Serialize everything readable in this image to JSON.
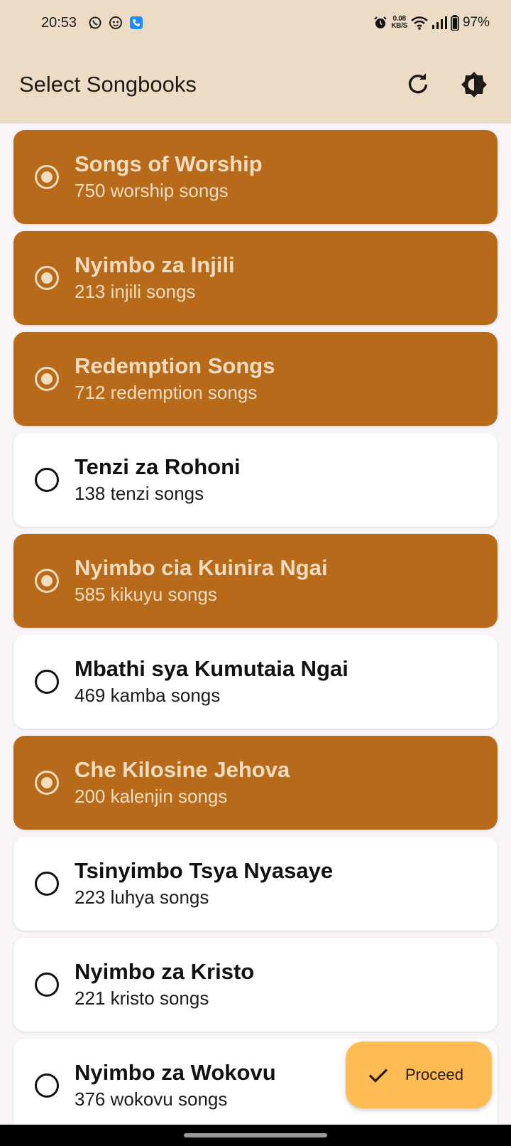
{
  "status_bar": {
    "time": "20:53",
    "net_speed_value": "0.08",
    "net_speed_unit": "KB/S",
    "battery": "97%",
    "notification_icons": [
      "whatsapp-icon",
      "messenger-icon",
      "phone-icon"
    ]
  },
  "app_bar": {
    "title": "Select Songbooks",
    "refresh_icon": "refresh-icon",
    "theme_icon": "brightness-icon"
  },
  "songbooks": [
    {
      "title": "Songs of Worship",
      "subtitle": "750 worship songs",
      "selected": true
    },
    {
      "title": "Nyimbo za Injili",
      "subtitle": "213 injili songs",
      "selected": true
    },
    {
      "title": "Redemption Songs",
      "subtitle": "712 redemption songs",
      "selected": true
    },
    {
      "title": "Tenzi za Rohoni",
      "subtitle": "138 tenzi songs",
      "selected": false
    },
    {
      "title": "Nyimbo cia Kuinira Ngai",
      "subtitle": "585 kikuyu songs",
      "selected": true
    },
    {
      "title": "Mbathi sya Kumutaia Ngai",
      "subtitle": "469 kamba songs",
      "selected": false
    },
    {
      "title": "Che Kilosine Jehova",
      "subtitle": "200 kalenjin songs",
      "selected": true
    },
    {
      "title": "Tsinyimbo Tsya Nyasaye",
      "subtitle": "223 luhya songs",
      "selected": false
    },
    {
      "title": "Nyimbo za Kristo",
      "subtitle": "221 kristo songs",
      "selected": false
    },
    {
      "title": "Nyimbo za Wokovu",
      "subtitle": "376 wokovu songs",
      "selected": false
    }
  ],
  "fab": {
    "label": "Proceed",
    "icon": "check-icon"
  },
  "colors": {
    "header_bg": "#ecdcc6",
    "selected_card": "#b66a1a",
    "selected_text": "#f3dcc0",
    "fab_bg": "#ffbc55",
    "page_bg": "#f9f4f7"
  }
}
